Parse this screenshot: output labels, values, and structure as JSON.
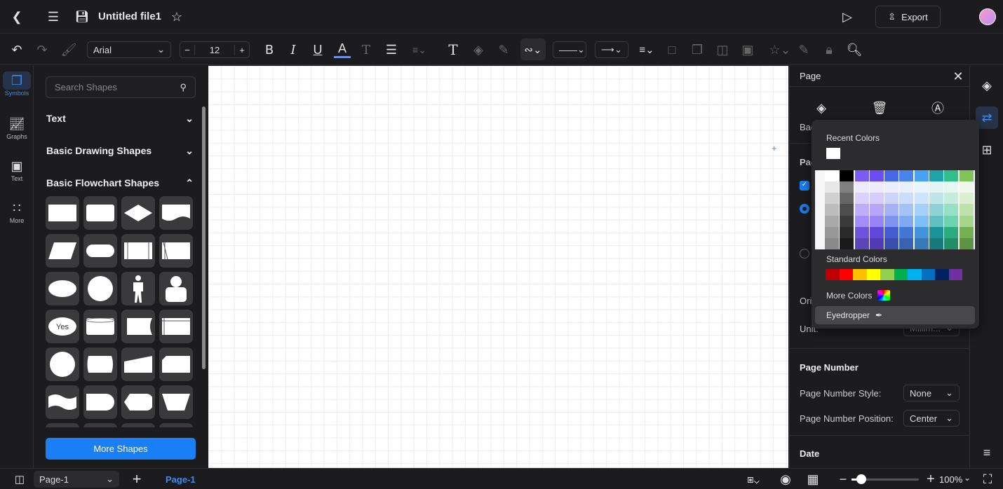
{
  "header": {
    "title": "Untitled file1",
    "export_label": "Export"
  },
  "toolbar": {
    "font": "Arial",
    "font_size": "12"
  },
  "rail": {
    "items": [
      {
        "label": "Symbols",
        "icon": "symbols-icon",
        "active": true
      },
      {
        "label": "Graphs",
        "icon": "graph-icon"
      },
      {
        "label": "Text",
        "icon": "text-icon"
      },
      {
        "label": "More",
        "icon": "grid-dots-icon"
      }
    ]
  },
  "shapes": {
    "search_placeholder": "Search Shapes",
    "sections": [
      {
        "label": "Text",
        "expanded": false
      },
      {
        "label": "Basic Drawing Shapes",
        "expanded": false
      },
      {
        "label": "Basic Flowchart Shapes",
        "expanded": true
      }
    ],
    "yes_label": "Yes",
    "more_label": "More Shapes"
  },
  "right_panel": {
    "title": "Page",
    "partial_labels": [
      "Bac",
      "Pag",
      "Ori",
      "Unit:"
    ],
    "unit_value": "Millim...",
    "page_number": {
      "heading": "Page Number",
      "style_label": "Page Number Style:",
      "style_value": "None",
      "position_label": "Page Number Position:",
      "position_value": "Center"
    },
    "date_heading": "Date"
  },
  "color_popup": {
    "recent_label": "Recent Colors",
    "recent": [
      "#ffffff"
    ],
    "palette_base": [
      "#ffffff",
      "#000000",
      "#7b5cf5",
      "#6a4ff0",
      "#4a66e8",
      "#4a84ea",
      "#4aa3f2",
      "#1fa3a8",
      "#2fbf8a",
      "#7fc45a"
    ],
    "standard_label": "Standard Colors",
    "standard": [
      "#c00000",
      "#ff0000",
      "#ffc000",
      "#ffff00",
      "#92d050",
      "#00b050",
      "#00b0f0",
      "#0070c0",
      "#002060",
      "#7030a0"
    ],
    "more_colors_label": "More Colors",
    "eyedropper_label": "Eyedropper"
  },
  "bottom": {
    "page_select": "Page-1",
    "active_tab": "Page-1",
    "zoom": "100%",
    "zoom_slider_percent": 15
  },
  "colors": {
    "accent": "#1a7ef5"
  }
}
